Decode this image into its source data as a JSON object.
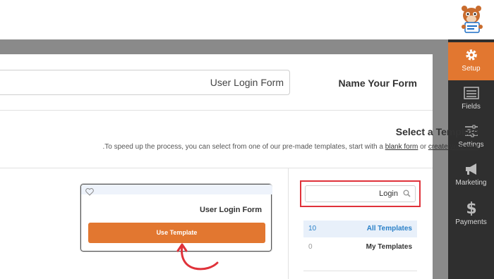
{
  "sidebar": {
    "items": [
      {
        "label": "Setup",
        "icon": "gear-icon",
        "active": true
      },
      {
        "label": "Fields",
        "icon": "fields-icon",
        "active": false
      },
      {
        "label": "Settings",
        "icon": "sliders-icon",
        "active": false
      },
      {
        "label": "Marketing",
        "icon": "megaphone-icon",
        "active": false
      },
      {
        "label": "Payments",
        "icon": "dollar-icon",
        "active": false
      }
    ]
  },
  "form_name": {
    "value": "User Login Form",
    "label": "Name Your Form"
  },
  "template_section": {
    "title": "Select a Template",
    "desc_prefix": ".To speed up the process, you can select from one of our pre-made templates, start with a ",
    "blank_form_link": "blank form",
    "desc_mid": " or ",
    "create_own_link": "create your own"
  },
  "template_card": {
    "title": "User Login Form",
    "button_label": "Use Template"
  },
  "search": {
    "value": "Login"
  },
  "categories": [
    {
      "count": "10",
      "name": "All Templates",
      "active": true
    },
    {
      "count": "0",
      "name": "My Templates",
      "active": false
    }
  ],
  "colors": {
    "accent": "#e27730",
    "highlight_red": "#e0323a",
    "link_blue": "#2a80c8",
    "sidebar_bg": "#2f2f2f"
  }
}
